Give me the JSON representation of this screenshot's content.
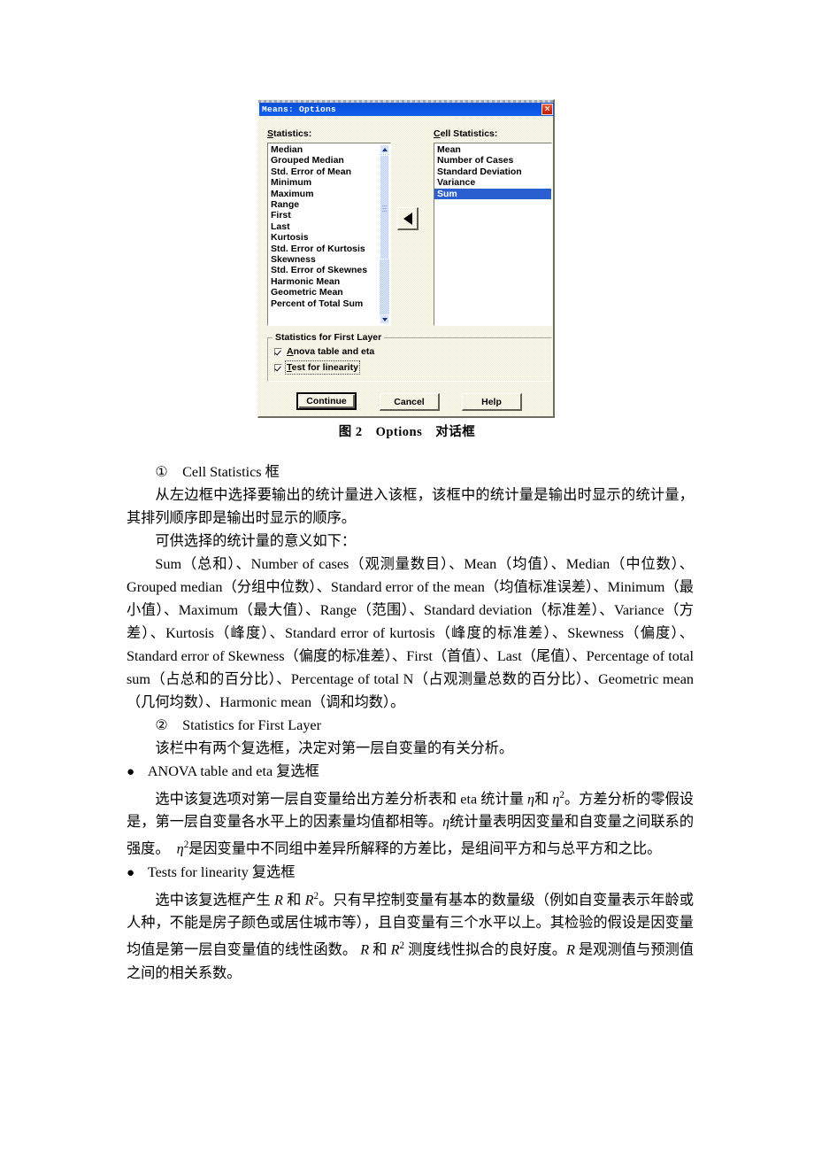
{
  "dialog": {
    "title": "Means: Options",
    "close_label": "×",
    "left_list_label_pre": "S",
    "left_list_label_rest": "tatistics:",
    "right_list_label_pre": "C",
    "right_list_label_rest": "ell Statistics:",
    "statistics": [
      "Median",
      "Grouped Median",
      "Std. Error of Mean",
      "Minimum",
      "Maximum",
      "Range",
      "First",
      "Last",
      "Kurtosis",
      "Std. Error of Kurtosis",
      "Skewness",
      "Std. Error of Skewnes",
      "Harmonic Mean",
      "Geometric Mean",
      "Percent of Total Sum"
    ],
    "cell_statistics": [
      {
        "label": "Mean",
        "selected": false
      },
      {
        "label": "Number of Cases",
        "selected": false
      },
      {
        "label": "Standard Deviation",
        "selected": false
      },
      {
        "label": "Variance",
        "selected": false
      },
      {
        "label": "Sum",
        "selected": true
      }
    ],
    "groupbox_title": "Statistics for First Layer",
    "checkbox1_accel": "A",
    "checkbox1_rest": "nova table and eta",
    "checkbox1_checked": true,
    "checkbox2_accel": "T",
    "checkbox2_rest": "est for linearity",
    "checkbox2_checked": true,
    "continue_label": "Continue",
    "cancel_label": "Cancel",
    "help_label": "Help",
    "titlebar_color": "#0a55e0",
    "selection_color": "#2a5fd0",
    "face_color": "#efeedd"
  },
  "figure_caption": "图 2 Options　对话框",
  "body": {
    "h1": "① Cell Statistics 框",
    "p1": "从左边框中选择要输出的统计量进入该框，该框中的统计量是输出时显示的统计量，其排列顺序即是输出时显示的顺序。",
    "p2": "可供选择的统计量的意义如下：",
    "p3": "Sum（总和）、Number of cases（观测量数目）、Mean（均值）、Median（中位数）、Grouped median（分组中位数）、Standard error of the mean（均值标准误差）、Minimum（最小值）、Maximum（最大值）、Range（范围）、Standard deviation（标准差）、Variance（方差）、Kurtosis（峰度）、Standard error of kurtosis（峰度的标准差）、Skewness（偏度）、Standard error of Skewness（偏度的标准差）、First（首值）、Last（尾值）、Percentage of total sum（占总和的百分比）、Percentage of total N（占观测量总数的百分比）、Geometric mean（几何均数）、Harmonic mean（调和均数）。",
    "h2": "② Statistics for First Layer",
    "p4": "该栏中有两个复选框，决定对第一层自变量的有关分析。",
    "bullet1": "ANOVA table and eta 复选框",
    "p5_a": "选中该复选项对第一层自变量给出方差分析表和 eta 统计量 ",
    "p5_eta1": "η",
    "p5_b": "和 ",
    "p5_eta2": "η",
    "p5_sup2": "2",
    "p5_c": "。方差分析的零假设是，第一层自变量各水平上的因素量均值都相等。",
    "p5_eta3": "η",
    "p5_d": "统计量表明因变量和自变量之间联系的强度。　",
    "p5_eta4": "η",
    "p5_sup2b": "2",
    "p5_e": "是因变量中不同组中差异所解释的方差比，是组间平方和与总平方和之比。",
    "bullet2": "Tests for linearity 复选框",
    "p6_a": "选中该复选框产生 ",
    "p6_R1": "R",
    "p6_b": " 和 ",
    "p6_R2": "R",
    "p6_sup2": "2",
    "p6_c": "。只有早控制变量有基本的数量级（例如自变量表示年龄或人种，不能是房子颜色或居住城市等），且自变量有三个水平以上。其检验的假设是因变量均值是第一层自变量值的线性函数。 ",
    "p6_R3": "R",
    "p6_d": " 和 ",
    "p6_R4": "R",
    "p6_sup2b": "2",
    "p6_e": " 测度线性拟合的良好度。",
    "p6_R5": "R",
    "p6_f": " 是观测值与预测值之间的相关系数。",
    "bullet_glyph": "●"
  }
}
